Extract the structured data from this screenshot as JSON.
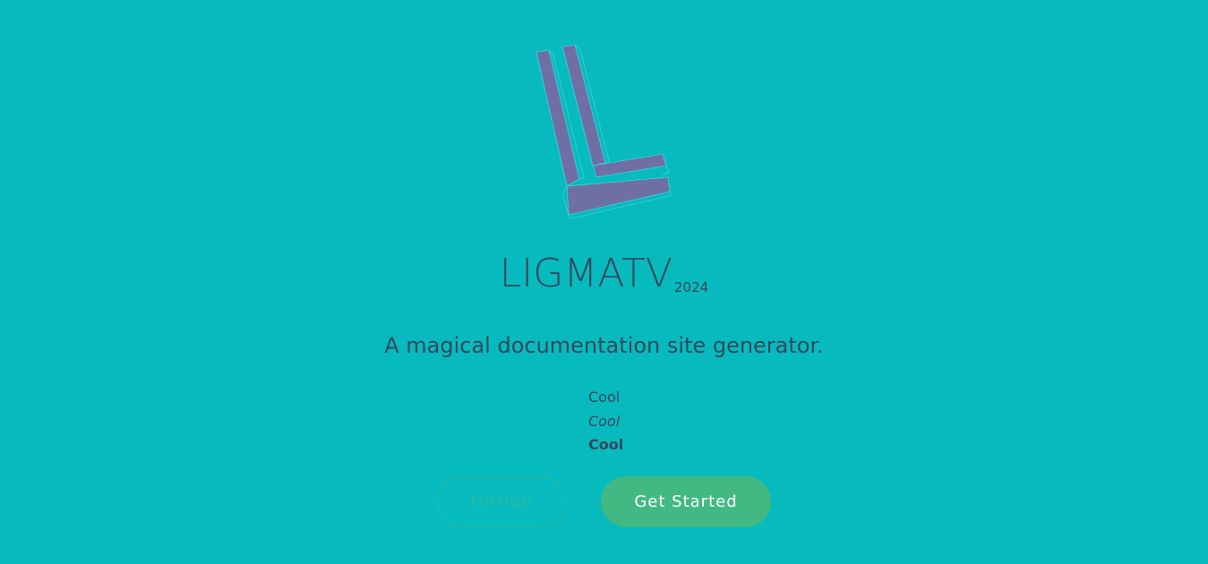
{
  "cover": {
    "background_color": "#07babe",
    "logo": {
      "icon": "ligmatv-logo-icon",
      "fill_color": "#6f6fa6",
      "outline_color": "#3fd6d9"
    },
    "title": "LIGMATV",
    "title_sub": "2024",
    "tagline": "A magical documentation site generator.",
    "features": [
      {
        "label": "Cool",
        "style": "normal"
      },
      {
        "label": "Cool",
        "style": "italic"
      },
      {
        "label": "Cool",
        "style": "bold"
      }
    ],
    "buttons": {
      "github_label": "GitHub",
      "get_started_label": "Get Started",
      "accent_color": "#42b983"
    }
  }
}
